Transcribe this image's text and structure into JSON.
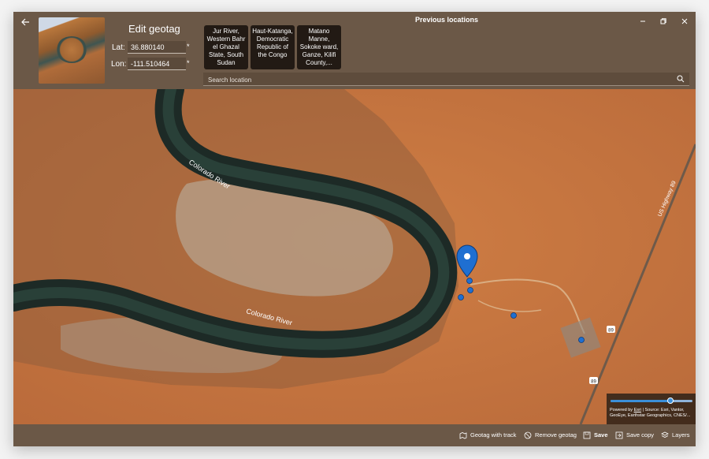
{
  "header": {
    "title": "Edit geotag",
    "lat_label": "Lat:",
    "lon_label": "Lon:",
    "lat_value": "36.880140",
    "lon_value": "-111.510464",
    "required_mark": "*",
    "previous_locations_title": "Previous locations",
    "previous_locations": [
      "Jur River, Western Bahr el Ghazal State, South Sudan",
      "Haut-Katanga, Democratic Republic of the Congo",
      "Matano Manne, Sokoke ward, Ganze, Kilifi County,..."
    ],
    "search_placeholder": "Search location"
  },
  "icons": {
    "back": "back-arrow-icon",
    "minimize": "minimize-icon",
    "restore": "restore-icon",
    "close": "close-icon",
    "search": "search-icon"
  },
  "map": {
    "river_labels": [
      "Colorado River",
      "Colorado River"
    ],
    "highway_label": "US Highway 89",
    "route_shields": [
      "89",
      "89"
    ],
    "zoom_level": 0.73,
    "attribution_prefix": "Powered by ",
    "attribution_link": "Esri",
    "attribution_text": " | Source: Esri, Vantor, GeoEye, Earthstar Geographics, CNES/..."
  },
  "footer": {
    "geotag_with_track": "Geotag with track",
    "remove_geotag": "Remove geotag",
    "save": "Save",
    "save_copy": "Save copy",
    "layers": "Layers"
  },
  "colors": {
    "chrome": "#6b5847",
    "marker": "#1f6fd1",
    "terrain": "#c8773d",
    "river": "#1d2a26"
  }
}
